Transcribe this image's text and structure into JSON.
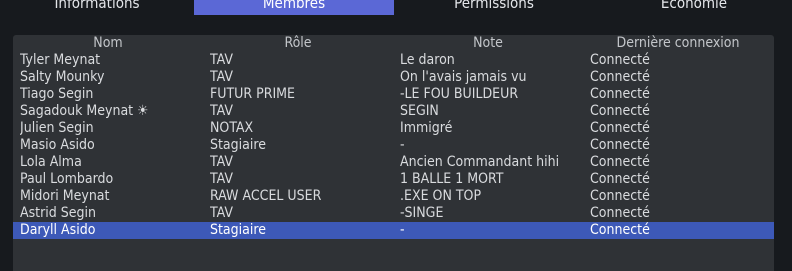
{
  "tabs": [
    {
      "label": "Informations",
      "active": false
    },
    {
      "label": "Membres",
      "active": true
    },
    {
      "label": "Permissions",
      "active": false
    },
    {
      "label": "Economie",
      "active": false
    }
  ],
  "table": {
    "columns": [
      "Nom",
      "Rôle",
      "Note",
      "Dernière connexion"
    ],
    "rows": [
      [
        "Tyler Meynat",
        "TAV",
        "Le daron",
        "Connecté"
      ],
      [
        "Salty Mounky",
        "TAV",
        "On l'avais jamais vu",
        "Connecté"
      ],
      [
        "Tiago Segin",
        "FUTUR PRIME",
        "-LE FOU BUILDEUR",
        "Connecté"
      ],
      [
        "Sagadouk Meynat ☀",
        "TAV",
        "SEGIN",
        "Connecté"
      ],
      [
        "Julien Segin",
        "NOTAX",
        "Immigré",
        "Connecté"
      ],
      [
        "Masio Asido",
        "Stagiaire",
        "-",
        "Connecté"
      ],
      [
        "Lola Alma",
        "TAV",
        "Ancien Commandant hihi",
        "Connecté"
      ],
      [
        "Paul Lombardo",
        "TAV",
        "1 BALLE 1 MORT",
        "Connecté"
      ],
      [
        "Midori Meynat",
        "RAW ACCEL USER",
        ".EXE ON TOP",
        "Connecté"
      ],
      [
        "Astrid Segin",
        "TAV",
        "-SINGE",
        "Connecté"
      ],
      [
        "Daryll Asido",
        "Stagiaire",
        "-",
        "Connecté"
      ]
    ],
    "selected_row": 10
  },
  "colors": {
    "background": "#171a1e",
    "panel": "#2f3236",
    "active_tab": "#5b68d6",
    "selected_row": "#3d59b8"
  }
}
